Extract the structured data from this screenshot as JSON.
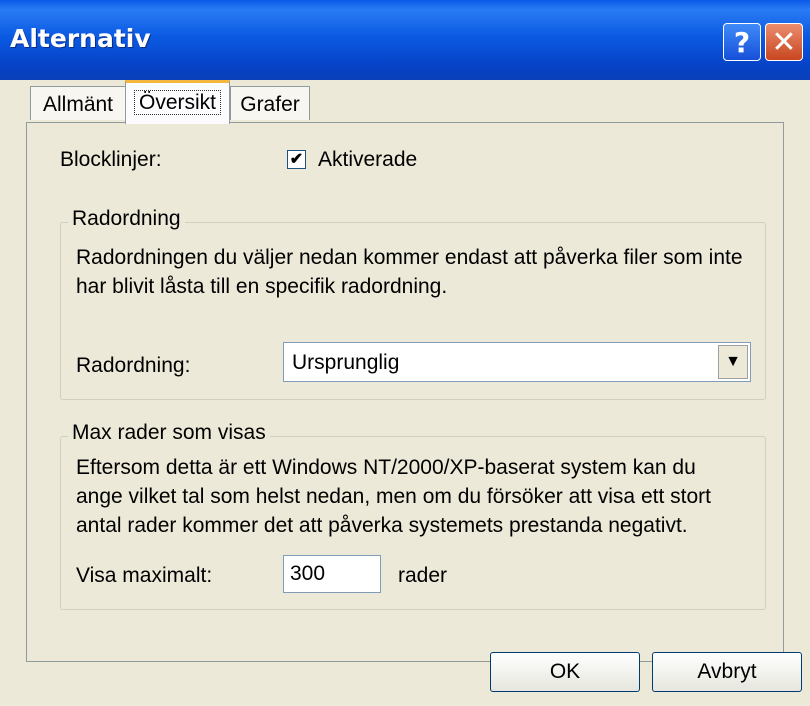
{
  "window": {
    "title": "Alternativ",
    "help_glyph": "?",
    "close_glyph": "✕"
  },
  "tabs": [
    {
      "label": "Allmänt"
    },
    {
      "label": "Översikt"
    },
    {
      "label": "Grafer"
    }
  ],
  "blocklinjer": {
    "label": "Blocklinjer:",
    "checkbox_label": "Aktiverade",
    "checked": true,
    "check_glyph": "✔"
  },
  "radordning_group": {
    "title": "Radordning",
    "description_line1": "Radordningen du väljer nedan kommer endast att påverka filer som inte",
    "description_line2": "har blivit låsta till en specifik radordning.",
    "field_label": "Radordning:",
    "selected_value": "Ursprunglig",
    "arrow_glyph": "▼"
  },
  "maxrader_group": {
    "title": "Max rader som visas",
    "description_line1": "Eftersom detta är ett Windows NT/2000/XP-baserat system kan du",
    "description_line2": "ange vilket tal som helst nedan, men om du försöker att visa ett stort",
    "description_line3": "antal rader kommer det att påverka systemets prestanda negativt.",
    "field_label": "Visa maximalt:",
    "value": "300",
    "unit": "rader"
  },
  "buttons": {
    "ok": "OK",
    "cancel": "Avbryt"
  }
}
